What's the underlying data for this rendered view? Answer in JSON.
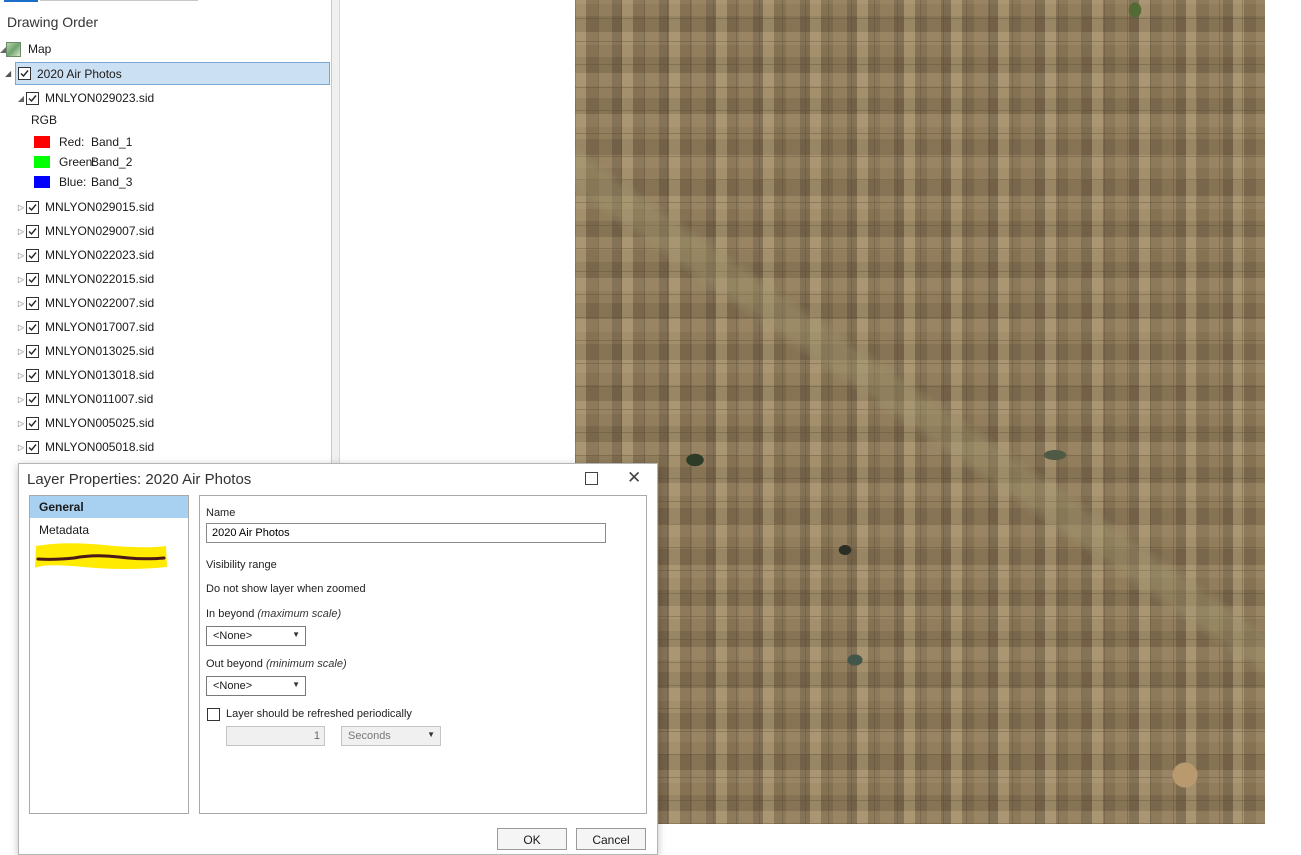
{
  "contents": {
    "header": "Drawing Order",
    "map_label": "Map",
    "layer_label": "2020 Air Photos",
    "expanded_raster": "MNLYON029023.sid",
    "rgb_label": "RGB",
    "bands": [
      {
        "label": "Red:",
        "value": "Band_1",
        "color": "#ff0000"
      },
      {
        "label": "Green:",
        "value": "Band_2",
        "color": "#00ff00"
      },
      {
        "label": "Blue:",
        "value": "Band_3",
        "color": "#0000ff"
      }
    ],
    "rasters": [
      "MNLYON029015.sid",
      "MNLYON029007.sid",
      "MNLYON022023.sid",
      "MNLYON022015.sid",
      "MNLYON022007.sid",
      "MNLYON017007.sid",
      "MNLYON013025.sid",
      "MNLYON013018.sid",
      "MNLYON011007.sid",
      "MNLYON005025.sid",
      "MNLYON005018.sid"
    ]
  },
  "dialog": {
    "title": "Layer Properties: 2020 Air Photos",
    "nav": {
      "general": "General",
      "metadata": "Metadata"
    },
    "name_label": "Name",
    "name_value": "2020 Air Photos",
    "visibility_range": "Visibility range",
    "do_not_show": "Do not show layer when zoomed",
    "in_beyond": "In beyond",
    "in_beyond_hint": "(maximum scale)",
    "in_beyond_value": "<None>",
    "out_beyond": "Out beyond",
    "out_beyond_hint": "(minimum scale)",
    "out_beyond_value": "<None>",
    "refresh_label": "Layer should be refreshed periodically",
    "refresh_interval": "1",
    "refresh_unit": "Seconds",
    "ok": "OK",
    "cancel": "Cancel"
  },
  "icons": {
    "checkbox": "check-icon",
    "expand": "triangle-right-icon",
    "collapse": "triangle-down-icon",
    "maximize": "maximize-icon",
    "close": "close-icon"
  }
}
